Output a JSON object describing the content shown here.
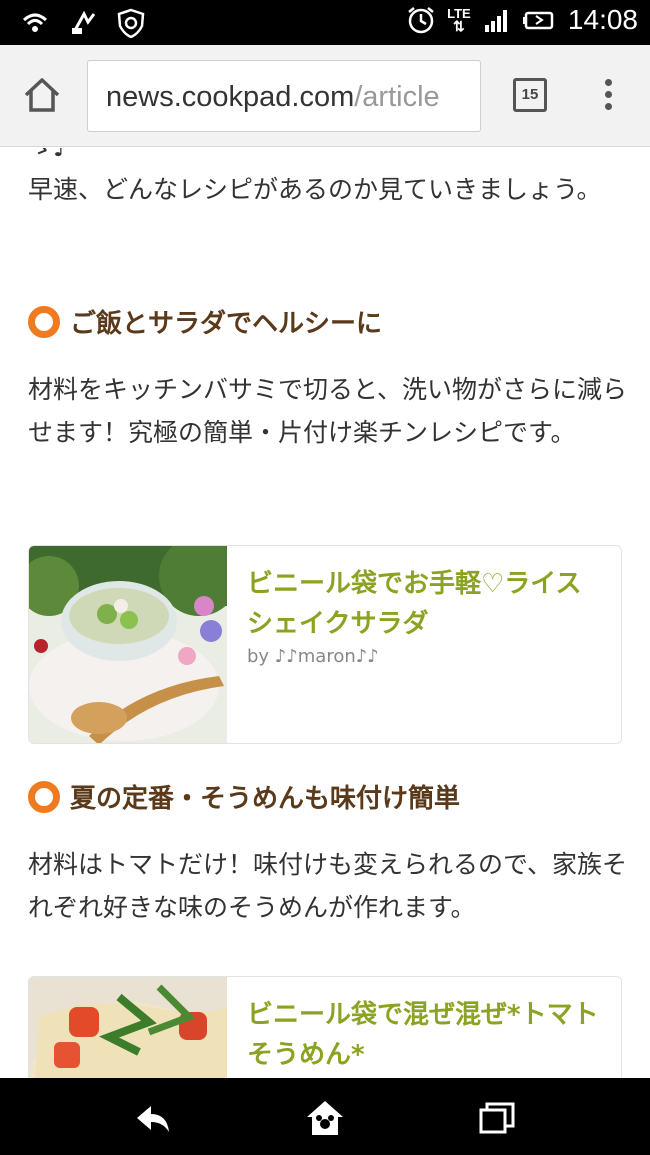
{
  "status_bar": {
    "time": "14:08",
    "network": "LTE",
    "icons": [
      "wifi-calling-icon",
      "nfc-icon",
      "shield-icon",
      "alarm-icon",
      "lte-icon",
      "signal-icon",
      "battery-icon"
    ]
  },
  "browser": {
    "url_main": "news.cookpad.com",
    "url_dim": "/article",
    "tab_count": "15",
    "icons": [
      "home-icon",
      "tabs-icon",
      "overflow-menu-icon"
    ]
  },
  "article": {
    "intro_fragment": "ゝ♪",
    "intro": "早速、どんなレシピがあるのか見ていきましょう。",
    "section1": {
      "heading": "ご飯とサラダでヘルシーに",
      "body": "材料をキッチンバサミで切ると、洗い物がさらに減らせます！究極の簡単・片付け楽チンレシピです。",
      "card": {
        "title": "ビニール袋でお手軽♡ライスシェイクサラダ",
        "author": "by ♪♪maron♪♪"
      }
    },
    "section2": {
      "heading": "夏の定番・そうめんも味付け簡単",
      "body": "材料はトマトだけ！味付けも変えられるので、家族それぞれ好きな味のそうめんが作れます。",
      "card": {
        "title": "ビニール袋で混ぜ混ぜ*トマトそうめん*"
      }
    }
  },
  "nav_bar": {
    "icons": [
      "back-icon",
      "home-icon",
      "recent-apps-icon"
    ]
  },
  "colors": {
    "heading_bullet": "#f07a1f",
    "heading_text": "#5a3a1a",
    "card_title": "#8aa422"
  }
}
